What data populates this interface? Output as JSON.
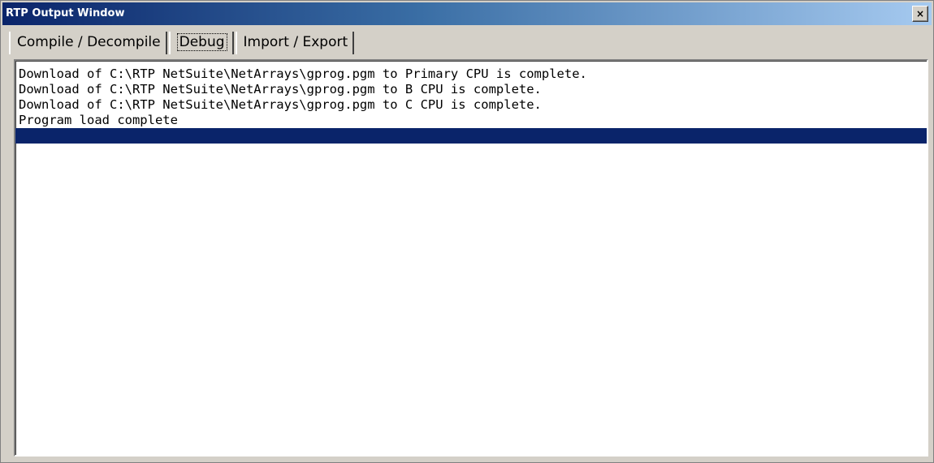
{
  "window": {
    "title": "RTP Output Window",
    "close_glyph": "×"
  },
  "tabs": [
    {
      "label": "Compile / Decompile",
      "selected": false
    },
    {
      "label": "Debug",
      "selected": true
    },
    {
      "label": "Import / Export",
      "selected": false
    }
  ],
  "output": {
    "lines": [
      "Download of C:\\RTP NetSuite\\NetArrays\\gprog.pgm to Primary CPU is complete.",
      "Download of C:\\RTP NetSuite\\NetArrays\\gprog.pgm to B CPU is complete.",
      "Download of C:\\RTP NetSuite\\NetArrays\\gprog.pgm to C CPU is complete.",
      "Program load complete",
      ""
    ],
    "selected_line": 4
  },
  "colors": {
    "title_bar": "#0a246a",
    "selection": "#0a246a",
    "face": "#d4d0c8"
  }
}
